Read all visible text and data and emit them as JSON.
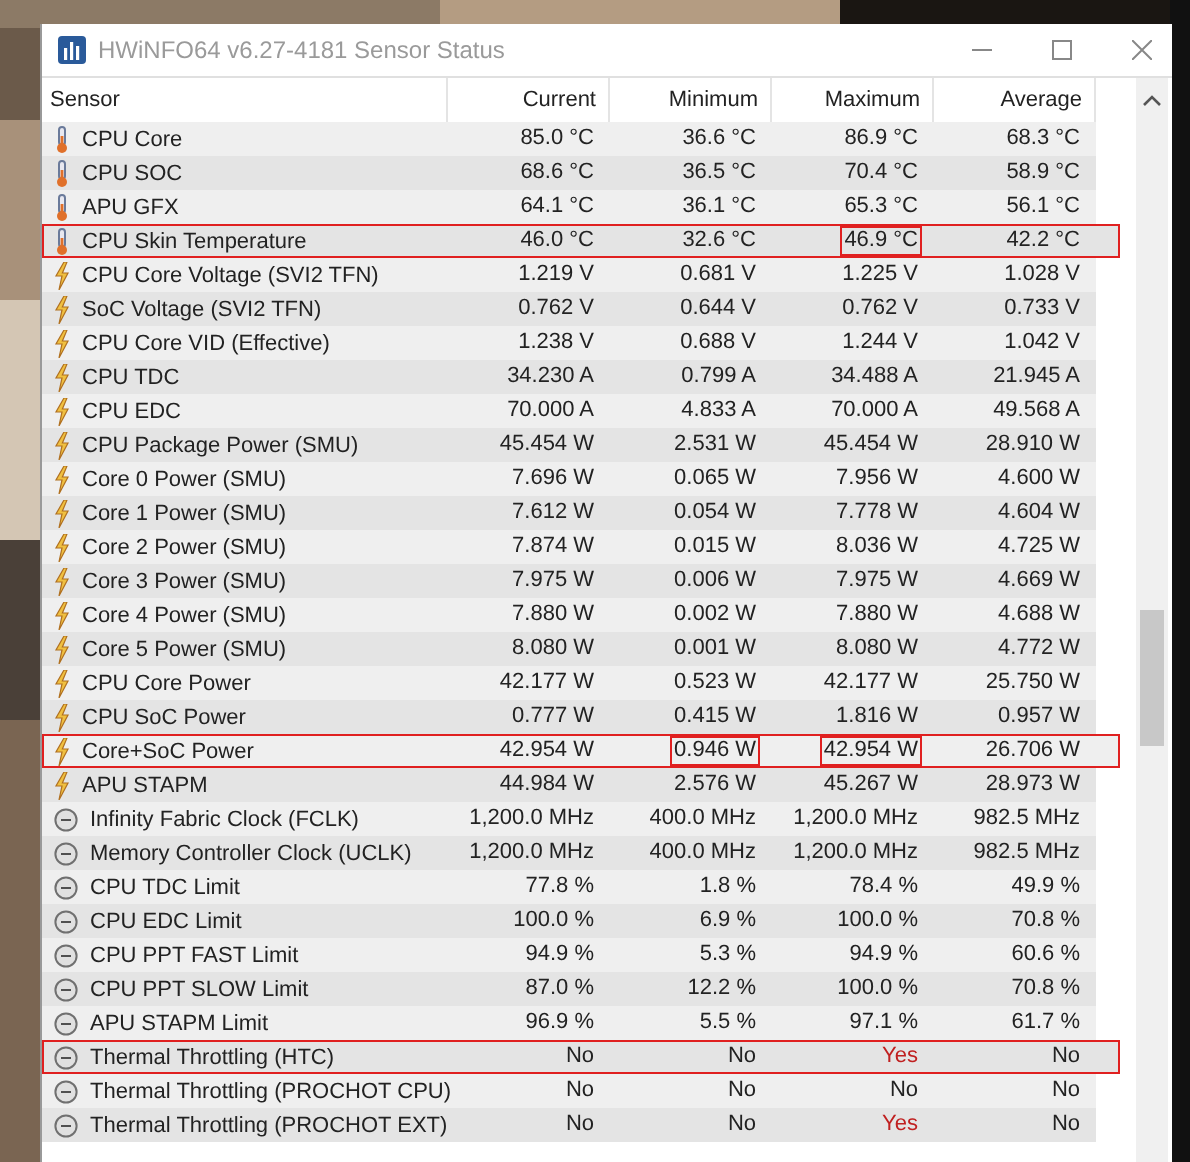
{
  "window": {
    "title": "HWiNFO64 v6.27-4181 Sensor Status"
  },
  "columns": [
    "Sensor",
    "Current",
    "Minimum",
    "Maximum",
    "Average"
  ],
  "rows": [
    {
      "kind": "temperature",
      "name": "CPU Core",
      "values": [
        "85.0 °C",
        "36.6 °C",
        "86.9 °C",
        "68.3 °C"
      ],
      "highlighted": false,
      "boxed": [
        false,
        false,
        false,
        false
      ],
      "alert": [
        false,
        false,
        false,
        false
      ]
    },
    {
      "kind": "temperature",
      "name": "CPU SOC",
      "values": [
        "68.6 °C",
        "36.5 °C",
        "70.4 °C",
        "58.9 °C"
      ],
      "highlighted": false,
      "boxed": [
        false,
        false,
        false,
        false
      ],
      "alert": [
        false,
        false,
        false,
        false
      ]
    },
    {
      "kind": "temperature",
      "name": "APU GFX",
      "values": [
        "64.1 °C",
        "36.1 °C",
        "65.3 °C",
        "56.1 °C"
      ],
      "highlighted": false,
      "boxed": [
        false,
        false,
        false,
        false
      ],
      "alert": [
        false,
        false,
        false,
        false
      ]
    },
    {
      "kind": "temperature",
      "name": "CPU Skin Temperature",
      "values": [
        "46.0 °C",
        "32.6 °C",
        "46.9 °C",
        "42.2 °C"
      ],
      "highlighted": true,
      "boxed": [
        false,
        false,
        true,
        false
      ],
      "alert": [
        false,
        false,
        false,
        false
      ]
    },
    {
      "kind": "power",
      "name": "CPU Core Voltage (SVI2 TFN)",
      "values": [
        "1.219 V",
        "0.681 V",
        "1.225 V",
        "1.028 V"
      ],
      "highlighted": false,
      "boxed": [
        false,
        false,
        false,
        false
      ],
      "alert": [
        false,
        false,
        false,
        false
      ]
    },
    {
      "kind": "power",
      "name": "SoC Voltage (SVI2 TFN)",
      "values": [
        "0.762 V",
        "0.644 V",
        "0.762 V",
        "0.733 V"
      ],
      "highlighted": false,
      "boxed": [
        false,
        false,
        false,
        false
      ],
      "alert": [
        false,
        false,
        false,
        false
      ]
    },
    {
      "kind": "power",
      "name": "CPU Core VID (Effective)",
      "values": [
        "1.238 V",
        "0.688 V",
        "1.244 V",
        "1.042 V"
      ],
      "highlighted": false,
      "boxed": [
        false,
        false,
        false,
        false
      ],
      "alert": [
        false,
        false,
        false,
        false
      ]
    },
    {
      "kind": "power",
      "name": "CPU TDC",
      "values": [
        "34.230 A",
        "0.799 A",
        "34.488 A",
        "21.945 A"
      ],
      "highlighted": false,
      "boxed": [
        false,
        false,
        false,
        false
      ],
      "alert": [
        false,
        false,
        false,
        false
      ]
    },
    {
      "kind": "power",
      "name": "CPU EDC",
      "values": [
        "70.000 A",
        "4.833 A",
        "70.000 A",
        "49.568 A"
      ],
      "highlighted": false,
      "boxed": [
        false,
        false,
        false,
        false
      ],
      "alert": [
        false,
        false,
        false,
        false
      ]
    },
    {
      "kind": "power",
      "name": "CPU Package Power (SMU)",
      "values": [
        "45.454 W",
        "2.531 W",
        "45.454 W",
        "28.910 W"
      ],
      "highlighted": false,
      "boxed": [
        false,
        false,
        false,
        false
      ],
      "alert": [
        false,
        false,
        false,
        false
      ]
    },
    {
      "kind": "power",
      "name": "Core 0 Power (SMU)",
      "values": [
        "7.696 W",
        "0.065 W",
        "7.956 W",
        "4.600 W"
      ],
      "highlighted": false,
      "boxed": [
        false,
        false,
        false,
        false
      ],
      "alert": [
        false,
        false,
        false,
        false
      ]
    },
    {
      "kind": "power",
      "name": "Core 1 Power (SMU)",
      "values": [
        "7.612 W",
        "0.054 W",
        "7.778 W",
        "4.604 W"
      ],
      "highlighted": false,
      "boxed": [
        false,
        false,
        false,
        false
      ],
      "alert": [
        false,
        false,
        false,
        false
      ]
    },
    {
      "kind": "power",
      "name": "Core 2 Power (SMU)",
      "values": [
        "7.874 W",
        "0.015 W",
        "8.036 W",
        "4.725 W"
      ],
      "highlighted": false,
      "boxed": [
        false,
        false,
        false,
        false
      ],
      "alert": [
        false,
        false,
        false,
        false
      ]
    },
    {
      "kind": "power",
      "name": "Core 3 Power (SMU)",
      "values": [
        "7.975 W",
        "0.006 W",
        "7.975 W",
        "4.669 W"
      ],
      "highlighted": false,
      "boxed": [
        false,
        false,
        false,
        false
      ],
      "alert": [
        false,
        false,
        false,
        false
      ]
    },
    {
      "kind": "power",
      "name": "Core 4 Power (SMU)",
      "values": [
        "7.880 W",
        "0.002 W",
        "7.880 W",
        "4.688 W"
      ],
      "highlighted": false,
      "boxed": [
        false,
        false,
        false,
        false
      ],
      "alert": [
        false,
        false,
        false,
        false
      ]
    },
    {
      "kind": "power",
      "name": "Core 5 Power (SMU)",
      "values": [
        "8.080 W",
        "0.001 W",
        "8.080 W",
        "4.772 W"
      ],
      "highlighted": false,
      "boxed": [
        false,
        false,
        false,
        false
      ],
      "alert": [
        false,
        false,
        false,
        false
      ]
    },
    {
      "kind": "power",
      "name": "CPU Core Power",
      "values": [
        "42.177 W",
        "0.523 W",
        "42.177 W",
        "25.750 W"
      ],
      "highlighted": false,
      "boxed": [
        false,
        false,
        false,
        false
      ],
      "alert": [
        false,
        false,
        false,
        false
      ]
    },
    {
      "kind": "power",
      "name": "CPU SoC Power",
      "values": [
        "0.777 W",
        "0.415 W",
        "1.816 W",
        "0.957 W"
      ],
      "highlighted": false,
      "boxed": [
        false,
        false,
        false,
        false
      ],
      "alert": [
        false,
        false,
        false,
        false
      ]
    },
    {
      "kind": "power",
      "name": "Core+SoC Power",
      "values": [
        "42.954 W",
        "0.946 W",
        "42.954 W",
        "26.706 W"
      ],
      "highlighted": true,
      "boxed": [
        false,
        true,
        true,
        false
      ],
      "alert": [
        false,
        false,
        false,
        false
      ]
    },
    {
      "kind": "power",
      "name": "APU STAPM",
      "values": [
        "44.984 W",
        "2.576 W",
        "45.267 W",
        "28.973 W"
      ],
      "highlighted": false,
      "boxed": [
        false,
        false,
        false,
        false
      ],
      "alert": [
        false,
        false,
        false,
        false
      ]
    },
    {
      "kind": "other",
      "name": "Infinity Fabric Clock (FCLK)",
      "values": [
        "1,200.0 MHz",
        "400.0 MHz",
        "1,200.0 MHz",
        "982.5 MHz"
      ],
      "highlighted": false,
      "boxed": [
        false,
        false,
        false,
        false
      ],
      "alert": [
        false,
        false,
        false,
        false
      ]
    },
    {
      "kind": "other",
      "name": "Memory Controller Clock (UCLK)",
      "values": [
        "1,200.0 MHz",
        "400.0 MHz",
        "1,200.0 MHz",
        "982.5 MHz"
      ],
      "highlighted": false,
      "boxed": [
        false,
        false,
        false,
        false
      ],
      "alert": [
        false,
        false,
        false,
        false
      ]
    },
    {
      "kind": "other",
      "name": "CPU TDC Limit",
      "values": [
        "77.8 %",
        "1.8 %",
        "78.4 %",
        "49.9 %"
      ],
      "highlighted": false,
      "boxed": [
        false,
        false,
        false,
        false
      ],
      "alert": [
        false,
        false,
        false,
        false
      ]
    },
    {
      "kind": "other",
      "name": "CPU EDC Limit",
      "values": [
        "100.0 %",
        "6.9 %",
        "100.0 %",
        "70.8 %"
      ],
      "highlighted": false,
      "boxed": [
        false,
        false,
        false,
        false
      ],
      "alert": [
        false,
        false,
        false,
        false
      ]
    },
    {
      "kind": "other",
      "name": "CPU PPT FAST Limit",
      "values": [
        "94.9 %",
        "5.3 %",
        "94.9 %",
        "60.6 %"
      ],
      "highlighted": false,
      "boxed": [
        false,
        false,
        false,
        false
      ],
      "alert": [
        false,
        false,
        false,
        false
      ]
    },
    {
      "kind": "other",
      "name": "CPU PPT SLOW Limit",
      "values": [
        "87.0 %",
        "12.2 %",
        "100.0 %",
        "70.8 %"
      ],
      "highlighted": false,
      "boxed": [
        false,
        false,
        false,
        false
      ],
      "alert": [
        false,
        false,
        false,
        false
      ]
    },
    {
      "kind": "other",
      "name": "APU STAPM Limit",
      "values": [
        "96.9 %",
        "5.5 %",
        "97.1 %",
        "61.7 %"
      ],
      "highlighted": false,
      "boxed": [
        false,
        false,
        false,
        false
      ],
      "alert": [
        false,
        false,
        false,
        false
      ]
    },
    {
      "kind": "other",
      "name": "Thermal Throttling (HTC)",
      "values": [
        "No",
        "No",
        "Yes",
        "No"
      ],
      "highlighted": true,
      "boxed": [
        false,
        false,
        false,
        false
      ],
      "alert": [
        false,
        false,
        true,
        false
      ]
    },
    {
      "kind": "other",
      "name": "Thermal Throttling (PROCHOT CPU)",
      "values": [
        "No",
        "No",
        "No",
        "No"
      ],
      "highlighted": false,
      "boxed": [
        false,
        false,
        false,
        false
      ],
      "alert": [
        false,
        false,
        false,
        false
      ]
    },
    {
      "kind": "other",
      "name": "Thermal Throttling (PROCHOT EXT)",
      "values": [
        "No",
        "No",
        "Yes",
        "No"
      ],
      "highlighted": false,
      "boxed": [
        false,
        false,
        false,
        false
      ],
      "alert": [
        false,
        false,
        true,
        false
      ]
    }
  ]
}
